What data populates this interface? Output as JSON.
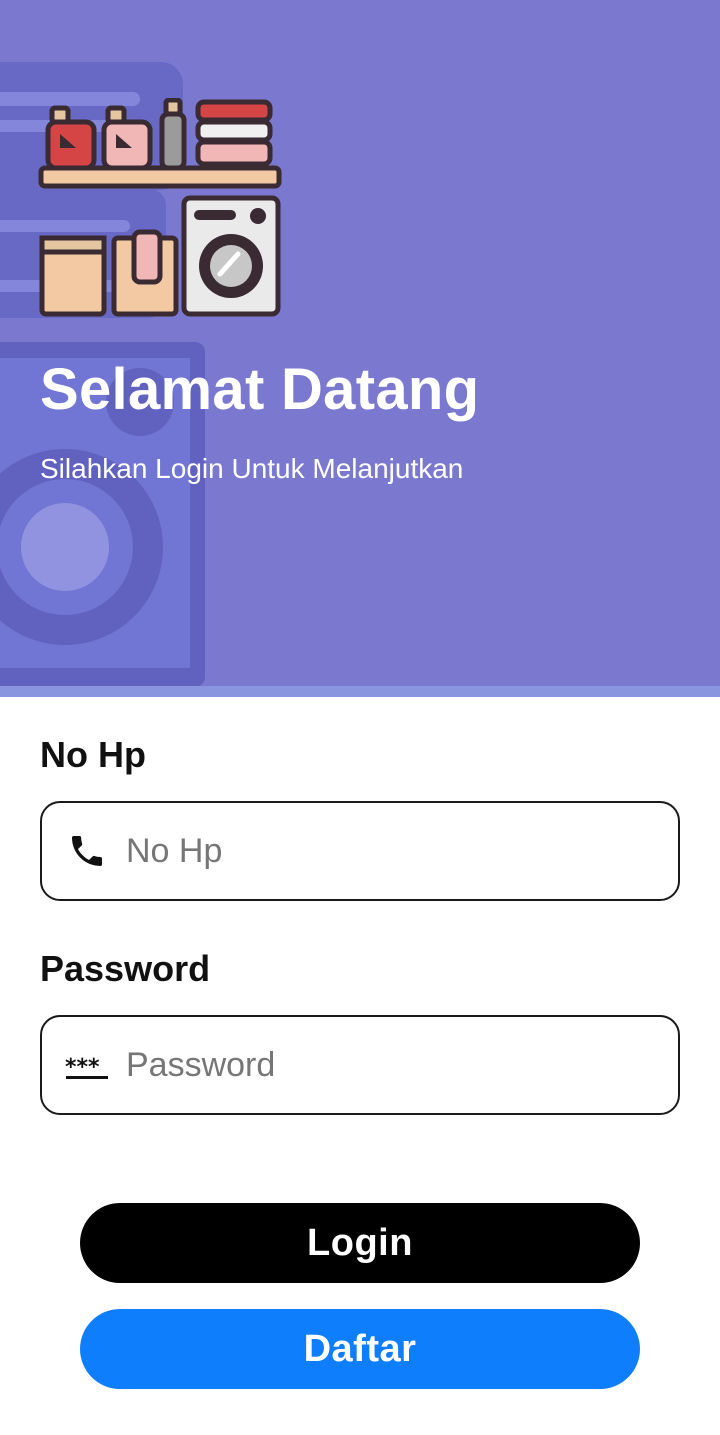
{
  "hero": {
    "title": "Selamat Datang",
    "subtitle": "Silahkan Login Untuk Melanjutkan",
    "background_color": "#7b78cf",
    "illustration": "laundry-shelf-washing-machine-illustration"
  },
  "form": {
    "phone": {
      "label": "No Hp",
      "placeholder": "No Hp",
      "value": "",
      "icon": "phone-icon"
    },
    "password": {
      "label": "Password",
      "placeholder": "Password",
      "value": "",
      "icon": "password-icon"
    }
  },
  "buttons": {
    "login_label": "Login",
    "login_color": "#000000",
    "register_label": "Daftar",
    "register_color": "#0f7efd"
  }
}
